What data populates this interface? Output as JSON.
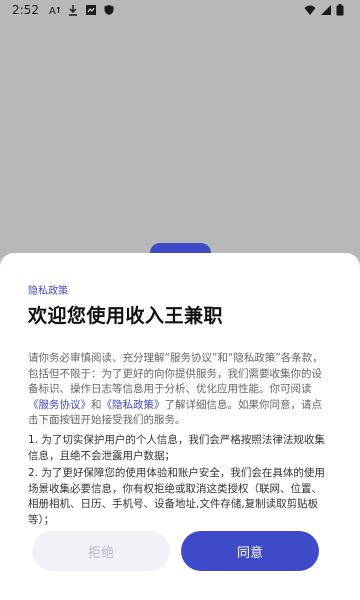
{
  "status_bar": {
    "time": "2:52"
  },
  "sheet": {
    "tag": "隐私政策",
    "title": "欢迎您使用收入王兼职",
    "intro_1": "请你务必审慎阅读、充分理解“服务协议”和“隐私政策”各条款，包括但不限于：为了更好的向你提供服务，我们需要收集你的设备标识、操作日志等信息用于分析、优化应用性能。你可阅读",
    "link_service": "《服务协议》",
    "and": "和",
    "link_privacy": "《隐私政策》",
    "intro_2": "了解详细信息。如果你同意，请点击下面按钮开始接受我们的服务。",
    "items": [
      "1. 为了切实保护用户的个人信息，我们会严格按照法律法规收集信息，且绝不会泄露用户数据；",
      "2. 为了更好保障您的使用体验和账户安全，我们会在具体的使用场景收集必要信息，你有权拒绝或取消这类授权（联网、位置、相册相机、日历、手机号、设备地址,文件存储,复制读取剪贴板等）；"
    ],
    "reject_label": "拒绝",
    "agree_label": "同意"
  },
  "colors": {
    "accent": "#3f4ac9",
    "scrim": "#b8b8b8"
  }
}
